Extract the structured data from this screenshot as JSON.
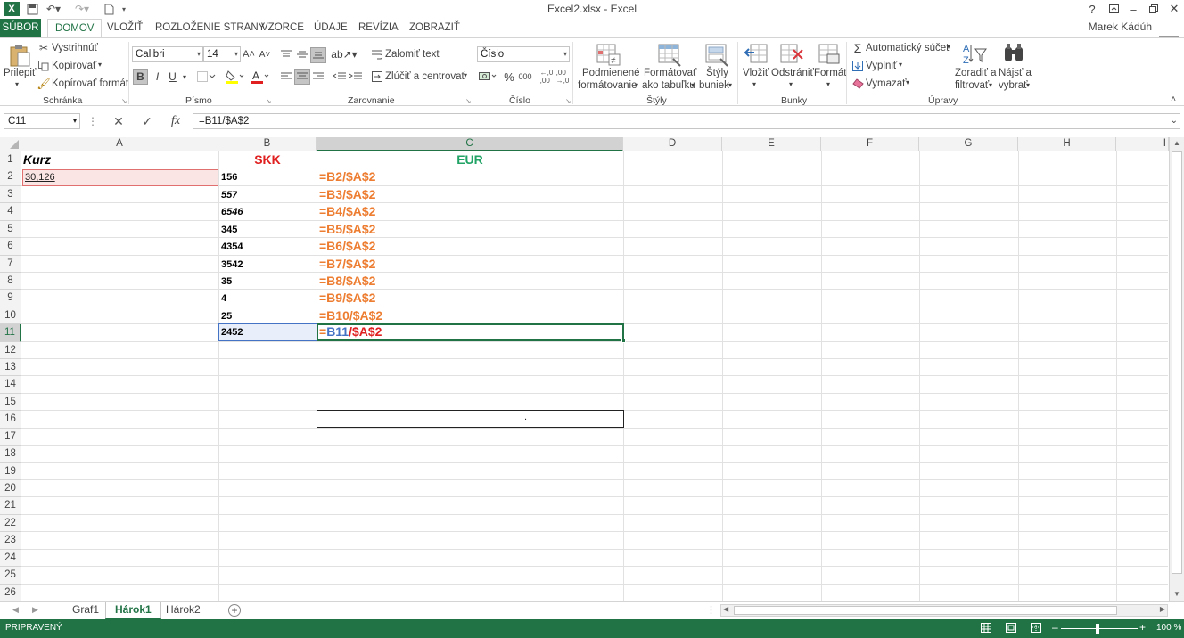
{
  "window": {
    "title": "Excel2.xlsx - Excel",
    "user": "Marek Kádúh",
    "help": "?"
  },
  "tabs": [
    {
      "label": "SÚBOR"
    },
    {
      "label": "DOMOV"
    },
    {
      "label": "VLOŽIŤ"
    },
    {
      "label": "ROZLOŽENIE STRANY"
    },
    {
      "label": "VZORCE"
    },
    {
      "label": "ÚDAJE"
    },
    {
      "label": "REVÍZIA"
    },
    {
      "label": "ZOBRAZIŤ"
    }
  ],
  "ribbon": {
    "clipboard": {
      "paste": "Prilepiť",
      "cut": "Vystrihnúť",
      "copy": "Kopírovať",
      "format_painter": "Kopírovať formát",
      "label": "Schránka"
    },
    "font": {
      "name": "Calibri",
      "size": "14",
      "bold": "B",
      "italic": "I",
      "underline": "U",
      "label": "Písmo"
    },
    "alignment": {
      "wrap": "Zalomiť text",
      "merge": "Zlúčiť a centrovať",
      "label": "Zarovnanie"
    },
    "number": {
      "format": "Číslo",
      "percent": "%",
      "thousands": "000",
      "label": "Číslo"
    },
    "styles": {
      "conditional_1": "Podmienené",
      "conditional_2": "formátovanie",
      "table_1": "Formátovať",
      "table_2": "ako tabuľku",
      "cell_1": "Štýly",
      "cell_2": "buniek",
      "label": "Štýly"
    },
    "cells": {
      "insert": "Vložiť",
      "delete": "Odstrániť",
      "format": "Formát",
      "label": "Bunky"
    },
    "editing": {
      "autosum": "Automatický súčet",
      "fill": "Vyplniť",
      "clear": "Vymazať",
      "sort_1": "Zoradiť a",
      "sort_2": "filtrovať",
      "find_1": "Nájsť a",
      "find_2": "vybrať",
      "label": "Úpravy"
    }
  },
  "formula_bar": {
    "name_box": "C11",
    "fx": "fx",
    "formula": "=B11/$A$2"
  },
  "columns": [
    "A",
    "B",
    "C",
    "D",
    "E",
    "F",
    "G",
    "H",
    "I"
  ],
  "rows": [
    "1",
    "2",
    "3",
    "4",
    "5",
    "6",
    "7",
    "8",
    "9",
    "10",
    "11",
    "12",
    "13",
    "14",
    "15",
    "16",
    "17",
    "18",
    "19",
    "20",
    "21",
    "22",
    "23",
    "24",
    "25",
    "26"
  ],
  "cells": {
    "A1": "Kurz",
    "A2": "30,126",
    "B1": "SKK",
    "C1": "EUR",
    "b_values": [
      "156",
      "557",
      "6546",
      "345",
      "4354",
      "3542",
      "35",
      "4",
      "25",
      "2452"
    ],
    "c_formulas": [
      "=B2/$A$2",
      "=B3/$A$2",
      "=B4/$A$2",
      "=B5/$A$2",
      "=B6/$A$2",
      "=B7/$A$2",
      "=B8/$A$2",
      "=B9/$A$2",
      "=B10/$A$2"
    ],
    "c11_eq": "=",
    "c11_ref": "B11",
    "c11_rest": "/$A$2",
    "c16": "."
  },
  "sheets": [
    "Graf1",
    "Hárok1",
    "Hárok2"
  ],
  "status": {
    "ready": "PRIPRAVENÝ",
    "zoom": "100 %"
  },
  "colors": {
    "accent": "#217346",
    "orange": "#ed7d31",
    "red": "#e02020",
    "green": "#21a366",
    "blue": "#4472c4"
  }
}
